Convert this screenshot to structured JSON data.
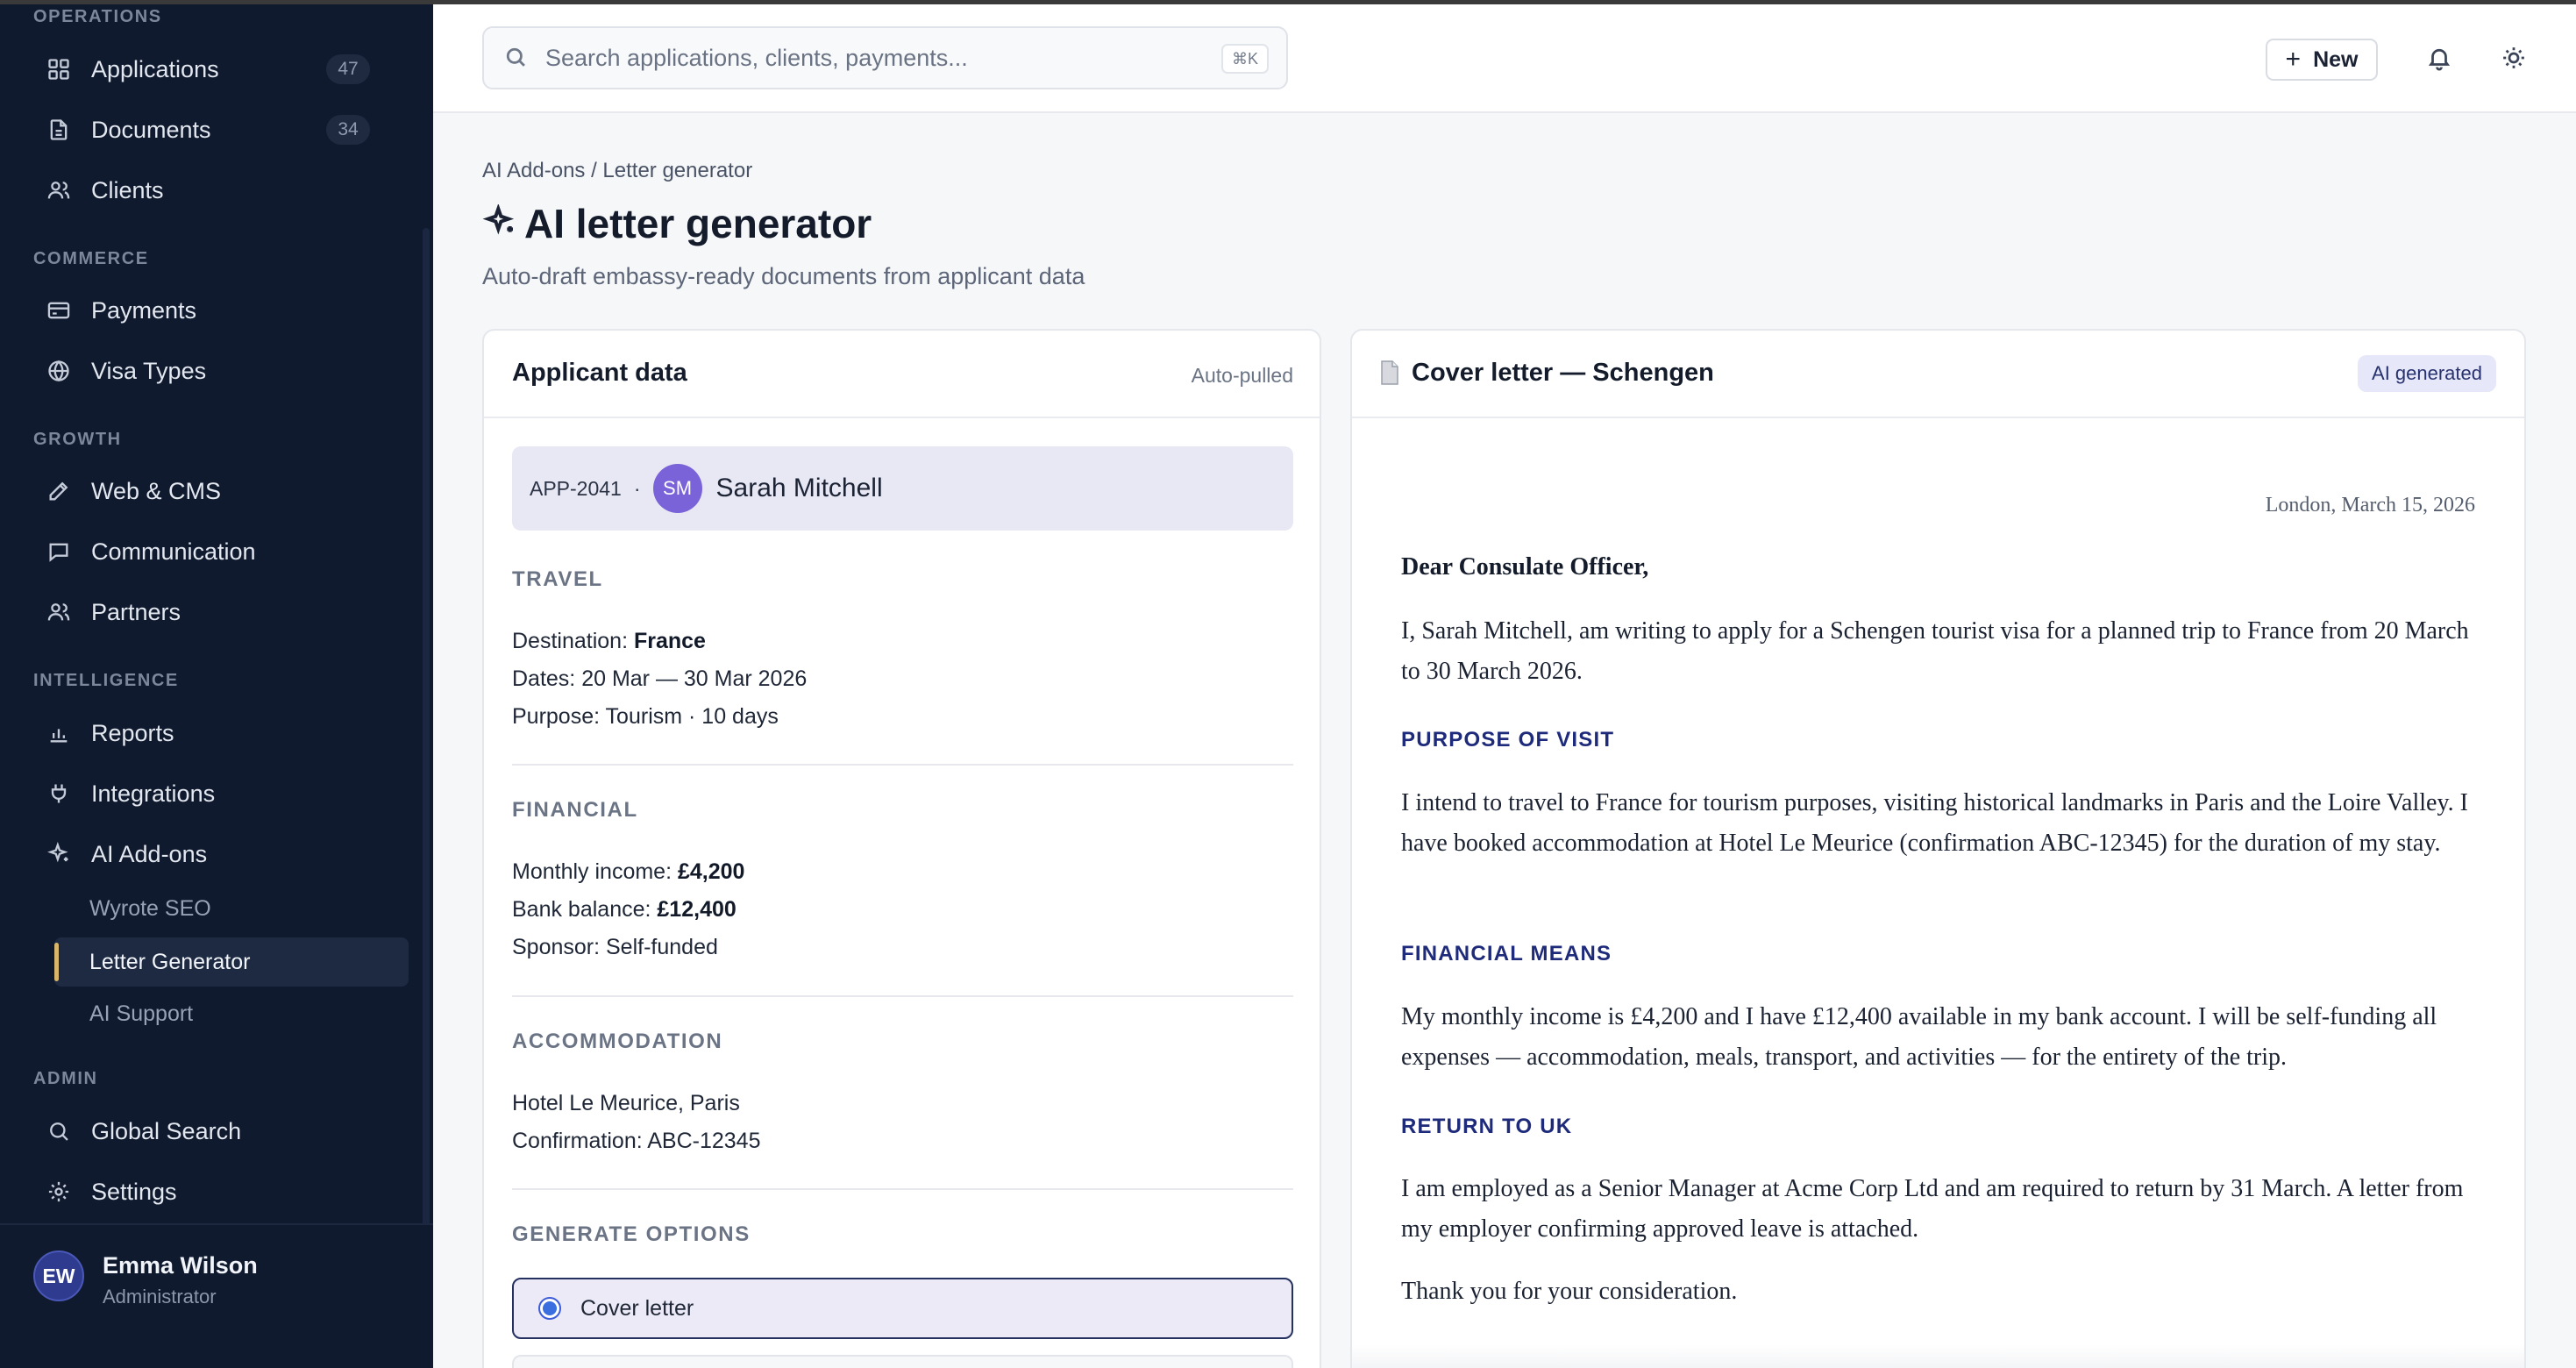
{
  "sidebar": {
    "sections": {
      "operations": "OPERATIONS",
      "commerce": "COMMERCE",
      "growth": "GROWTH",
      "intelligence": "INTELLIGENCE",
      "admin": "ADMIN"
    },
    "items": {
      "applications": {
        "label": "Applications",
        "count": "47",
        "icon": "grid-icon"
      },
      "documents": {
        "label": "Documents",
        "count": "34",
        "icon": "document-icon"
      },
      "clients": {
        "label": "Clients",
        "icon": "users-icon"
      },
      "payments": {
        "label": "Payments",
        "icon": "credit-card-icon"
      },
      "visa_types": {
        "label": "Visa Types",
        "icon": "globe-icon"
      },
      "web_cms": {
        "label": "Web & CMS",
        "icon": "pencil-icon"
      },
      "communication": {
        "label": "Communication",
        "icon": "chat-icon"
      },
      "partners": {
        "label": "Partners",
        "icon": "users-icon"
      },
      "reports": {
        "label": "Reports",
        "icon": "bar-chart-icon"
      },
      "integrations": {
        "label": "Integrations",
        "icon": "plug-icon"
      },
      "ai_addons": {
        "label": "AI Add-ons",
        "icon": "sparkle-icon"
      },
      "global_search": {
        "label": "Global Search",
        "icon": "search-icon"
      },
      "settings": {
        "label": "Settings",
        "icon": "gear-icon"
      }
    },
    "ai_subitems": {
      "wyrote_seo": "Wyrote SEO",
      "letter_generator": "Letter Generator",
      "ai_support": "AI Support"
    },
    "user": {
      "initials": "EW",
      "name": "Emma Wilson",
      "role": "Administrator"
    }
  },
  "topbar": {
    "search_placeholder": "Search applications, clients, payments...",
    "shortcut": "⌘K",
    "new_label": "New"
  },
  "page": {
    "breadcrumb": "AI Add-ons / Letter generator",
    "title": "AI letter generator",
    "subtitle": "Auto-draft embassy-ready documents from applicant data"
  },
  "applicant": {
    "card_title": "Applicant data",
    "card_meta": "Auto-pulled",
    "app_id": "APP-2041",
    "separator": "·",
    "initials": "SM",
    "name": "Sarah Mitchell",
    "travel": {
      "label": "TRAVEL",
      "destination_prefix": "Destination: ",
      "destination": "France",
      "dates": "Dates: 20 Mar — 30 Mar 2026",
      "purpose": "Purpose: Tourism · 10 days"
    },
    "financial": {
      "label": "FINANCIAL",
      "income_prefix": "Monthly income: ",
      "income": "£4,200",
      "balance_prefix": "Bank balance: ",
      "balance": "£12,400",
      "sponsor": "Sponsor: Self-funded"
    },
    "accommodation": {
      "label": "ACCOMMODATION",
      "hotel": "Hotel Le Meurice, Paris",
      "confirmation": "Confirmation: ABC-12345"
    },
    "options": {
      "label": "GENERATE OPTIONS",
      "selected": "Cover letter"
    }
  },
  "letter": {
    "title": "Cover letter — Schengen",
    "badge": "AI generated",
    "date": "London, March 15, 2026",
    "salutation": "Dear Consulate Officer,",
    "intro": "I, Sarah Mitchell, am writing to apply for a Schengen tourist visa for a planned trip to France from 20 March to 30 March 2026.",
    "purpose_heading": "PURPOSE OF VISIT",
    "purpose": "I intend to travel to France for tourism purposes, visiting historical landmarks in Paris and the Loire Valley. I have booked accommodation at Hotel Le Meurice (confirmation ABC-12345) for the duration of my stay.",
    "financial_heading": "FINANCIAL MEANS",
    "financial": "My monthly income is £4,200 and I have £12,400 available in my bank account. I will be self-funding all expenses — accommodation, meals, transport, and activities — for the entirety of the trip.",
    "return_heading": "RETURN TO UK",
    "return": "I am employed as a Senior Manager at Acme Corp Ltd and am required to return by 31 March. A letter from my employer confirming approved leave is attached.",
    "closing": "Thank you for your consideration."
  }
}
